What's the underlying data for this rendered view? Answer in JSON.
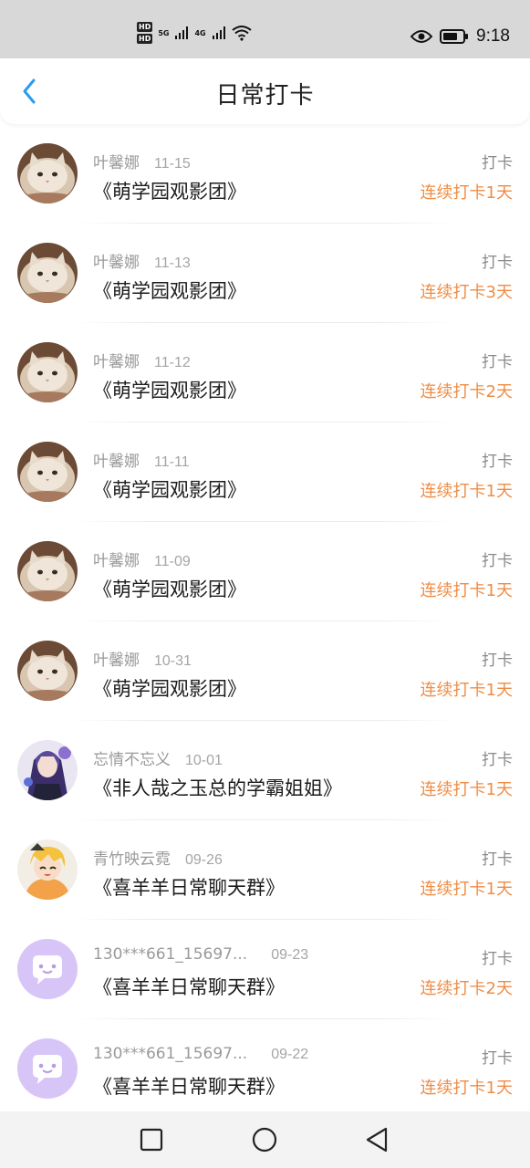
{
  "status_bar": {
    "hd1": "HD",
    "hd2": "HD",
    "net1": "5G",
    "net2": "4G",
    "time": "9:18"
  },
  "header": {
    "title": "日常打卡"
  },
  "rows": [
    {
      "name": "叶馨娜",
      "date": "11-15",
      "group": "《萌学园观影团》",
      "action": "打卡",
      "streak": "连续打卡1天",
      "avatar": "cat"
    },
    {
      "name": "叶馨娜",
      "date": "11-13",
      "group": "《萌学园观影团》",
      "action": "打卡",
      "streak": "连续打卡3天",
      "avatar": "cat"
    },
    {
      "name": "叶馨娜",
      "date": "11-12",
      "group": "《萌学园观影团》",
      "action": "打卡",
      "streak": "连续打卡2天",
      "avatar": "cat"
    },
    {
      "name": "叶馨娜",
      "date": "11-11",
      "group": "《萌学园观影团》",
      "action": "打卡",
      "streak": "连续打卡1天",
      "avatar": "cat"
    },
    {
      "name": "叶馨娜",
      "date": "11-09",
      "group": "《萌学园观影团》",
      "action": "打卡",
      "streak": "连续打卡1天",
      "avatar": "cat"
    },
    {
      "name": "叶馨娜",
      "date": "10-31",
      "group": "《萌学园观影团》",
      "action": "打卡",
      "streak": "连续打卡1天",
      "avatar": "cat"
    },
    {
      "name": "忘情不忘义",
      "date": "10-01",
      "group": "《非人哉之玉总的学霸姐姐》",
      "action": "打卡",
      "streak": "连续打卡1天",
      "avatar": "anime-purple"
    },
    {
      "name": "青竹映云霓",
      "date": "09-26",
      "group": "《喜羊羊日常聊天群》",
      "action": "打卡",
      "streak": "连续打卡1天",
      "avatar": "anime-orange"
    },
    {
      "name": "130***661_15697...",
      "date": "09-23",
      "group": "《喜羊羊日常聊天群》",
      "action": "打卡",
      "streak": "连续打卡2天",
      "avatar": "default-bubble"
    },
    {
      "name": "130***661_15697...",
      "date": "09-22",
      "group": "《喜羊羊日常聊天群》",
      "action": "打卡",
      "streak": "连续打卡1天",
      "avatar": "default-bubble"
    }
  ],
  "colors": {
    "accent_blue": "#2a9bf0",
    "streak_orange": "#ef8c44",
    "default_avatar_purple": "#d8c5f7"
  },
  "nav": {
    "icons": [
      "square-icon",
      "circle-icon",
      "triangle-back-icon"
    ]
  }
}
